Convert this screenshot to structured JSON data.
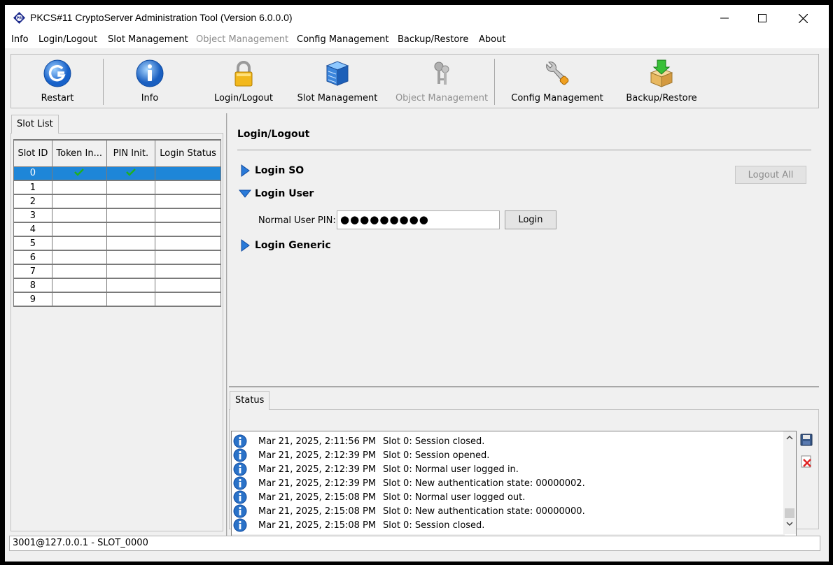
{
  "window": {
    "title": "PKCS#11 CryptoServer Administration Tool (Version 6.0.0.0)",
    "app_icon": "pkcs11-app-icon",
    "controls": [
      "minimize-icon",
      "maximize-icon",
      "close-icon"
    ]
  },
  "menu": {
    "items": [
      {
        "label": "Info",
        "enabled": true
      },
      {
        "label": "Login/Logout",
        "enabled": true
      },
      {
        "label": "Slot Management",
        "enabled": true
      },
      {
        "label": "Object Management",
        "enabled": false
      },
      {
        "label": "Config Management",
        "enabled": true
      },
      {
        "label": "Backup/Restore",
        "enabled": true
      },
      {
        "label": "About",
        "enabled": true
      }
    ]
  },
  "toolbar": {
    "buttons": [
      {
        "label": "Restart",
        "icon": "restart-icon",
        "enabled": true
      },
      {
        "label": "Info",
        "icon": "info-icon",
        "enabled": true
      },
      {
        "label": "Login/Logout",
        "icon": "padlock-icon",
        "enabled": true
      },
      {
        "label": "Slot Management",
        "icon": "slot-cabinet-icon",
        "enabled": true
      },
      {
        "label": "Object Management",
        "icon": "keys-icon",
        "enabled": false
      },
      {
        "label": "Config Management",
        "icon": "wrench-icon",
        "enabled": true
      },
      {
        "label": "Backup/Restore",
        "icon": "backup-box-icon",
        "enabled": true
      }
    ]
  },
  "slot_list": {
    "tab_label": "Slot List",
    "columns": [
      "Slot ID",
      "Token In...",
      "PIN Init.",
      "Login Status"
    ],
    "rows": [
      {
        "id": "0",
        "token_init": true,
        "pin_init": true,
        "login_status": "",
        "selected": true
      },
      {
        "id": "1",
        "token_init": false,
        "pin_init": false,
        "login_status": ""
      },
      {
        "id": "2",
        "token_init": false,
        "pin_init": false,
        "login_status": ""
      },
      {
        "id": "3",
        "token_init": false,
        "pin_init": false,
        "login_status": ""
      },
      {
        "id": "4",
        "token_init": false,
        "pin_init": false,
        "login_status": ""
      },
      {
        "id": "5",
        "token_init": false,
        "pin_init": false,
        "login_status": ""
      },
      {
        "id": "6",
        "token_init": false,
        "pin_init": false,
        "login_status": ""
      },
      {
        "id": "7",
        "token_init": false,
        "pin_init": false,
        "login_status": ""
      },
      {
        "id": "8",
        "token_init": false,
        "pin_init": false,
        "login_status": ""
      },
      {
        "id": "9",
        "token_init": false,
        "pin_init": false,
        "login_status": ""
      }
    ]
  },
  "login_panel": {
    "title": "Login/Logout",
    "sections": [
      {
        "label": "Login SO",
        "expanded": false
      },
      {
        "label": "Login User",
        "expanded": true
      },
      {
        "label": "Login Generic",
        "expanded": false
      }
    ],
    "logout_all_label": "Logout All",
    "pin_label": "Normal User PIN:",
    "pin_value": "●●●●●●●●●",
    "login_button": "Login"
  },
  "status": {
    "tab_label": "Status",
    "entries": [
      {
        "time": "Mar 21, 2025, 2:11:56 PM",
        "message": "Slot 0: Session closed."
      },
      {
        "time": "Mar 21, 2025, 2:12:39 PM",
        "message": "Slot 0: Session opened."
      },
      {
        "time": "Mar 21, 2025, 2:12:39 PM",
        "message": "Slot 0: Normal user logged in."
      },
      {
        "time": "Mar 21, 2025, 2:12:39 PM",
        "message": "Slot 0: New authentication state: 00000002."
      },
      {
        "time": "Mar 21, 2025, 2:15:08 PM",
        "message": "Slot 0: Normal user logged out."
      },
      {
        "time": "Mar 21, 2025, 2:15:08 PM",
        "message": "Slot 0: New authentication state: 00000000."
      },
      {
        "time": "Mar 21, 2025, 2:15:08 PM",
        "message": "Slot 0: Session closed."
      }
    ],
    "side_tools": [
      "save-log-icon",
      "clear-log-icon"
    ]
  },
  "statusbar": {
    "text": "3001@127.0.0.1 - SLOT_0000"
  },
  "colors": {
    "selection": "#1e86d8",
    "check": "#20b020",
    "disabled_text": "#8c8c8c"
  }
}
